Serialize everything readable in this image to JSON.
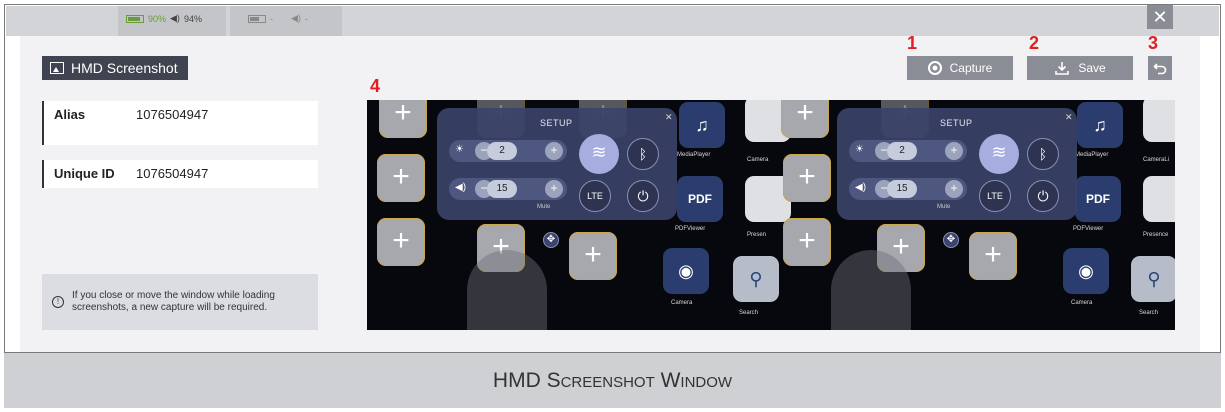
{
  "status_bar": {
    "battery_1": "90%",
    "volume_1": "94%",
    "battery_2": "-",
    "volume_2": "-"
  },
  "window": {
    "title": "HMD Screenshot",
    "close_icon": "close-icon"
  },
  "fields": [
    {
      "label": "Alias",
      "value": "1076504947"
    },
    {
      "label": "Unique ID",
      "value": "1076504947"
    }
  ],
  "note": {
    "line1": "If you close or move the window while loading",
    "line2": "screenshots, a new capture will be required."
  },
  "toolbar": {
    "capture_label": "Capture",
    "save_label": "Save",
    "callout_capture": "1",
    "callout_save": "2",
    "callout_undo": "3",
    "callout_preview": "4"
  },
  "preview": {
    "setup_title": "SETUP",
    "brightness_value": "2",
    "volume_value": "15",
    "lte_label": "LTE",
    "mute_label": "Mute",
    "apps": {
      "media_player": "MediaPlayer",
      "camera_app": "Camera",
      "pdf_viewer": "PDFViewer",
      "presence": "Presen",
      "camera": "Camera",
      "search": "Search"
    },
    "apps_right": {
      "media_player": "MediaPlayer",
      "camera_app": "CameraLi",
      "pdf_viewer": "PDFViewer",
      "presence": "Presence",
      "camera": "Camera",
      "search": "Search"
    }
  },
  "caption": "HMD Screenshot Window",
  "colors": {
    "accent_button": "#8b8d96",
    "title_chip": "#3f4450",
    "callout_red": "#e02020"
  }
}
